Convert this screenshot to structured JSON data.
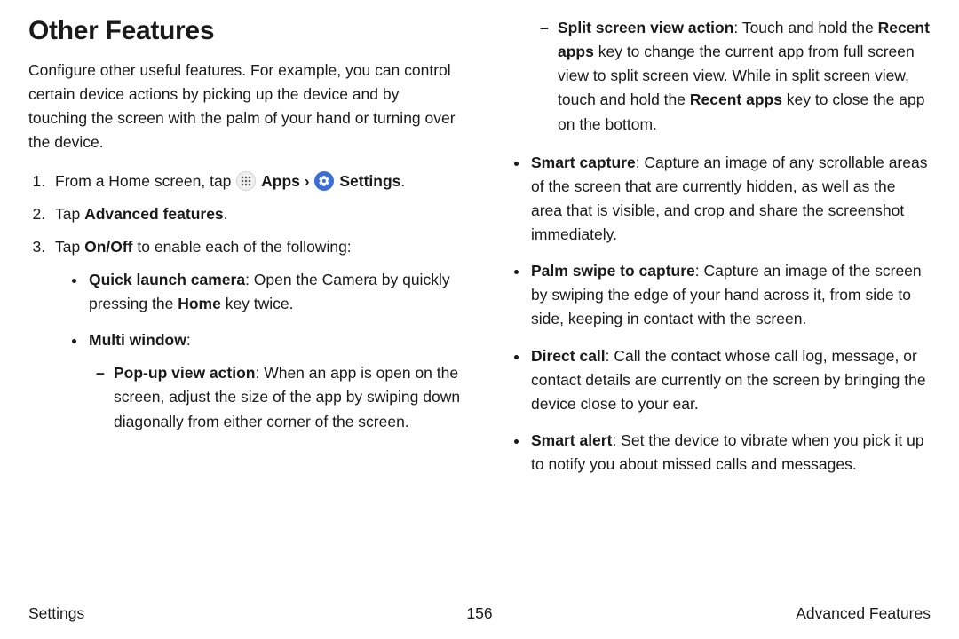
{
  "heading": "Other Features",
  "intro": "Configure other useful features. For example, you can control certain device actions by picking up the device and by touching the screen with the palm of your hand or turning over the device.",
  "step1": {
    "prefix": "From a Home screen, tap ",
    "apps": "Apps",
    "chev": "›",
    "settings": "Settings",
    "suffix": "."
  },
  "step2": {
    "prefix": "Tap ",
    "bold": "Advanced features",
    "suffix": "."
  },
  "step3": {
    "prefix": "Tap ",
    "bold": "On/Off",
    "suffix": " to enable each of the following:"
  },
  "bullets_left": {
    "quick_launch": {
      "title": "Quick launch camera",
      "body1": ": Open the Camera by quickly pressing the ",
      "home": "Home",
      "body2": " key twice."
    },
    "multi_window": {
      "title": "Multi window",
      "colon": ":"
    },
    "popup": {
      "title": "Pop-up view action",
      "body": ": When an app is open on the screen, adjust the size of the app by swiping down diagonally from either corner of the screen."
    }
  },
  "bullets_right": {
    "split": {
      "title": "Split screen view action",
      "body1": ": Touch and hold the ",
      "recent1": "Recent apps",
      "body2": " key to change the current app from full screen view to split screen view. While in split screen view, touch and hold the ",
      "recent2": "Recent apps",
      "body3": " key to close the app on the bottom."
    },
    "smart_capture": {
      "title": "Smart capture",
      "body": ": Capture an image of any scrollable areas of the screen that are currently hidden, as well as the area that is visible, and crop and share the screenshot immediately."
    },
    "palm_swipe": {
      "title": "Palm swipe to capture",
      "body": ": Capture an image of the screen by swiping the edge of your hand across it, from side to side, keeping in contact with the screen."
    },
    "direct_call": {
      "title": "Direct call",
      "body": ": Call the contact whose call log, message, or contact details are currently on the screen by bringing the device close to your ear."
    },
    "smart_alert": {
      "title": "Smart alert",
      "body": ": Set the device to vibrate when you pick it up to notify you about missed calls and messages."
    }
  },
  "footer": {
    "left": "Settings",
    "page": "156",
    "right": "Advanced Features"
  }
}
